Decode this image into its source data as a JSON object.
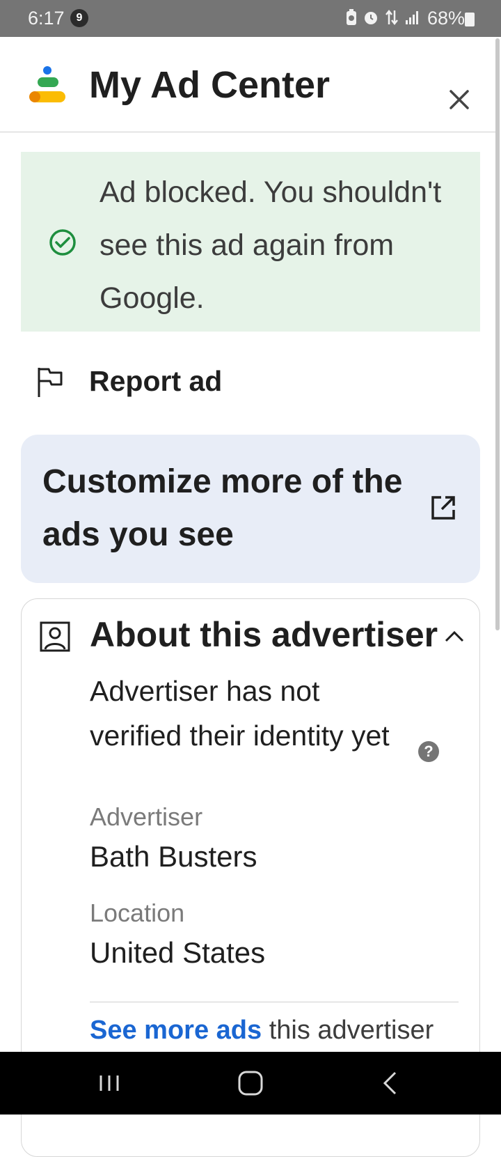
{
  "status_bar": {
    "time": "6:17",
    "notification_count": "9",
    "battery_percent": "68%",
    "icons": [
      "battery-saver-icon",
      "alarm-icon",
      "data-transfer-icon",
      "signal-icon",
      "battery-icon"
    ]
  },
  "header": {
    "title": "My Ad Center",
    "logo_colors": [
      "#1a73e8",
      "#34a853",
      "#fbbc04",
      "#ea8600"
    ]
  },
  "banner": {
    "message": "Ad blocked. You shouldn't see this ad again from Google.",
    "color": "#e6f3e8",
    "check_color": "#1e8e3e"
  },
  "report": {
    "label": "Report ad"
  },
  "customize": {
    "label": "Customize more of the ads you see",
    "color": "#e8edf7"
  },
  "advertiser": {
    "heading": "About this advertiser",
    "verification_text": "Advertiser has not verified their identity yet",
    "help_symbol": "?",
    "advertiser_label": "Advertiser",
    "advertiser_name": "Bath Busters",
    "location_label": "Location",
    "location_value": "United States",
    "see_more_link": "See more ads",
    "see_more_rest": " this advertiser"
  },
  "accent_link_color": "#1a66d2"
}
